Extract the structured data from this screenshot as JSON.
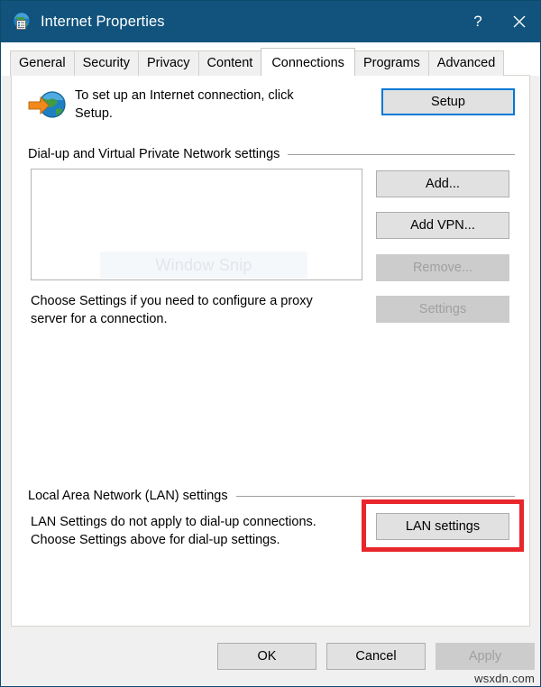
{
  "window": {
    "title": "Internet Properties",
    "icon": "internet-properties-icon",
    "titlebar_color": "#11537d",
    "help_label": "?",
    "close_label": "✕"
  },
  "tabs": [
    {
      "label": "General",
      "active": false
    },
    {
      "label": "Security",
      "active": false
    },
    {
      "label": "Privacy",
      "active": false
    },
    {
      "label": "Content",
      "active": false
    },
    {
      "label": "Connections",
      "active": true
    },
    {
      "label": "Programs",
      "active": false
    },
    {
      "label": "Advanced",
      "active": false
    }
  ],
  "setup": {
    "icon": "globe-with-arrow-icon",
    "description": "To set up an Internet connection, click Setup.",
    "button_label": "Setup"
  },
  "dialup": {
    "group_label": "Dial-up and Virtual Private Network settings",
    "listbox_items": [],
    "listbox_watermark": "Window Snip",
    "buttons": [
      {
        "label": "Add...",
        "enabled": true
      },
      {
        "label": "Add VPN...",
        "enabled": true
      },
      {
        "label": "Remove...",
        "enabled": false
      },
      {
        "label": "Settings",
        "enabled": false
      }
    ],
    "proxy_hint": "Choose Settings if you need to configure a proxy server for a connection."
  },
  "lan": {
    "group_label": "Local Area Network (LAN) settings",
    "hint": "LAN Settings do not apply to dial-up connections. Choose Settings above for dial-up settings.",
    "button_label": "LAN settings",
    "highlight_color": "#e8262b"
  },
  "footer": {
    "ok_label": "OK",
    "cancel_label": "Cancel",
    "apply_label": "Apply",
    "apply_enabled": false
  },
  "watermark": "wsxdn.com"
}
